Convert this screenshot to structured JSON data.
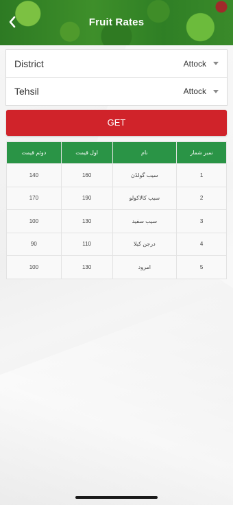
{
  "header": {
    "title": "Fruit Rates",
    "back_icon": "chevron-left-icon"
  },
  "form": {
    "district": {
      "label": "District",
      "value": "Attock"
    },
    "tehsil": {
      "label": "Tehsil",
      "value": "Attock"
    }
  },
  "get_button": {
    "label": "GET"
  },
  "table": {
    "headers": [
      "دوئم قیمت",
      "اول قیمت",
      "نام",
      "نمبر شمار"
    ],
    "rows": [
      [
        "140",
        "160",
        "سیب گولڈن",
        "1"
      ],
      [
        "170",
        "190",
        "سیب کالاکولو",
        "2"
      ],
      [
        "100",
        "130",
        "سیب سفید",
        "3"
      ],
      [
        "90",
        "110",
        "درجن کیلا",
        "4"
      ],
      [
        "100",
        "130",
        "امرود",
        "5"
      ]
    ]
  },
  "colors": {
    "header_green": "#2d7a23",
    "button_red": "#d0232a",
    "table_header_green": "#2a9446"
  }
}
